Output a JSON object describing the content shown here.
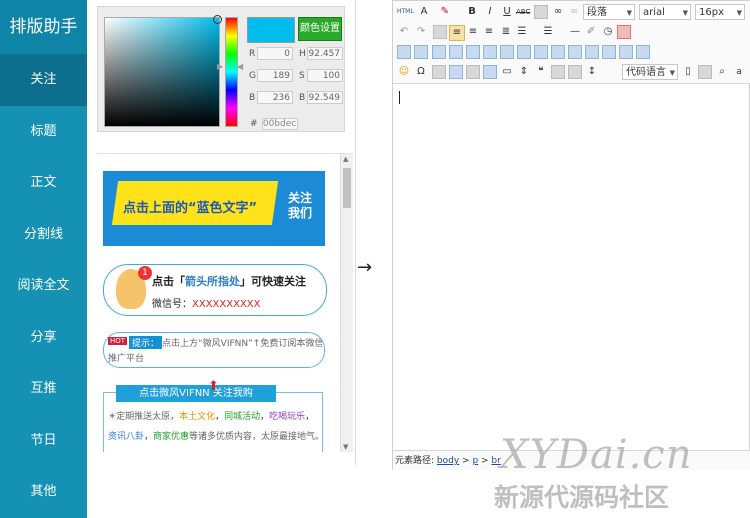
{
  "sidebar": {
    "title": "排版助手",
    "items": [
      "关注",
      "标题",
      "正文",
      "分割线",
      "阅读全文",
      "分享",
      "互推",
      "节日",
      "其他"
    ]
  },
  "color_picker": {
    "button": "颜色设置",
    "fields": [
      {
        "label": "R",
        "value": "0"
      },
      {
        "label": "H",
        "value": "92.457"
      },
      {
        "label": "G",
        "value": "189"
      },
      {
        "label": "S",
        "value": "100"
      },
      {
        "label": "B",
        "value": "236"
      },
      {
        "label": "B",
        "value": "92.549"
      }
    ],
    "hex_label": "#",
    "hex": "00bdec",
    "color": "#00bdec"
  },
  "templates": {
    "banner_text": "点击上面的“蓝色文字”",
    "banner_follow": "关注我们",
    "tip1_prefix": "点击「",
    "tip1_highlight": "箭头所指处",
    "tip1_suffix": "」可快速关注",
    "tip1_badge": "1",
    "tip1_wechat_label": "微信号：",
    "tip1_wechat_value": "XXXXXXXXXX",
    "hot": "HOT",
    "tip2_label": "提示：",
    "tip2_text": "点击上方“微风VIFNN”↑免费订阅本微信",
    "tip2_text2": "推广平台",
    "box3_head": "点击微风VIFNN 关注我购",
    "box3_l1a": "☀定期推送太原，",
    "box3_l1b": "本土文化",
    "box3_l1c": "，",
    "box3_l1d": "同城活动",
    "box3_l1e": "，",
    "box3_l1f": "吃喝玩乐",
    "box3_l1g": "，",
    "box3_l2a": "资讯八卦",
    "box3_l2b": "，",
    "box3_l2c": "商家优惠",
    "box3_l2d": "等诸多优质内容，太原最接地气。"
  },
  "arrow": "→",
  "editor": {
    "paragraph_select": "段落",
    "font_select": "arial",
    "size_select": "16px",
    "code_select": "代码语言",
    "status_label": "元素路径: ",
    "path_body": "body",
    "path_p": "p",
    "path_br": "br",
    "sep": " > "
  },
  "watermark": {
    "line1": "XYDai.cn",
    "line2": "新源代源码社区"
  }
}
